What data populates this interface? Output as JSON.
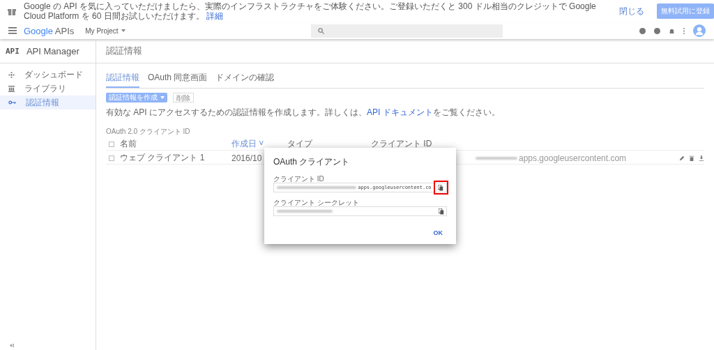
{
  "banner": {
    "text": "Google の API を気に入っていただけましたら、実際のインフラストラクチャをご体験ください。ご登録いただくと 300 ドル相当のクレジットで Google Cloud Platform を 60 日間お試しいただけます。",
    "link": "詳細",
    "dismiss": "閉じる",
    "signup": "無料試用に登録"
  },
  "header": {
    "logo_google": "Google",
    "logo_apis": "APIs",
    "project": "My Project"
  },
  "sidebar": {
    "title": "API Manager",
    "badge": "API",
    "items": [
      {
        "label": "ダッシュボード",
        "kind": "dashboard",
        "selected": false
      },
      {
        "label": "ライブラリ",
        "kind": "library",
        "selected": false
      },
      {
        "label": "認証情報",
        "kind": "key",
        "selected": true
      }
    ]
  },
  "page": {
    "title": "認証情報",
    "tabs": [
      {
        "label": "認証情報",
        "selected": true
      },
      {
        "label": "OAuth 同意画面",
        "selected": false
      },
      {
        "label": "ドメインの確認",
        "selected": false
      }
    ],
    "create_button": "認証情報を作成",
    "delete_button": "削除",
    "description": "有効な API にアクセスするための認証情報を作成します。詳しくは、",
    "doc_link": "API ドキュメント",
    "description_end": "をご覧ください。",
    "section": "OAuth 2.0 クライアント ID",
    "table": {
      "select_all_checked": false,
      "sort_indicator": "˅",
      "columns": [
        "名前",
        "作成日",
        "タイプ",
        "クライアント ID"
      ],
      "rows": [
        {
          "name": "ウェブ クライアント 1",
          "date": "2016/10",
          "client_id": "apps.googleusercontent.com",
          "checked": false
        }
      ]
    }
  },
  "dialog": {
    "title": "OAuth クライアント",
    "fields": [
      {
        "label": "クライアント ID",
        "value": "apps.googleusercontent.co",
        "highlighted": true
      },
      {
        "label": "クライアント シークレット",
        "highlighted": false
      }
    ],
    "ok": "OK"
  }
}
